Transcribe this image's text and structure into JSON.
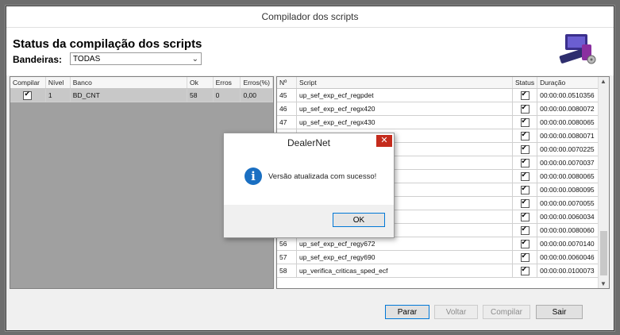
{
  "window": {
    "title": "Compilador dos scripts"
  },
  "header": {
    "title": "Status da compilação dos scripts",
    "flag_label": "Bandeiras:",
    "flag_value": "TODAS"
  },
  "left_grid": {
    "columns": [
      "Compilar",
      "Nível",
      "Banco",
      "Ok",
      "Erros",
      "Erros(%)"
    ],
    "rows": [
      {
        "compilar": true,
        "nivel": "1",
        "banco": "BD_CNT",
        "ok": "58",
        "erros": "0",
        "erros_pct": "0,00"
      }
    ]
  },
  "right_grid": {
    "columns": [
      "Nº",
      "Script",
      "Status",
      "Duração"
    ],
    "rows": [
      {
        "n": "45",
        "script": "up_sef_exp_ecf_regpdet",
        "status": true,
        "duracao": "00:00:00.0510356"
      },
      {
        "n": "46",
        "script": "up_sef_exp_ecf_regx420",
        "status": true,
        "duracao": "00:00:00.0080072"
      },
      {
        "n": "47",
        "script": "up_sef_exp_ecf_regx430",
        "status": true,
        "duracao": "00:00:00.0080065"
      },
      {
        "n": "",
        "script": "",
        "status": true,
        "duracao": "00:00:00.0080071"
      },
      {
        "n": "",
        "script": "",
        "status": true,
        "duracao": "00:00:00.0070225"
      },
      {
        "n": "",
        "script": "",
        "status": true,
        "duracao": "00:00:00.0070037"
      },
      {
        "n": "",
        "script": "",
        "status": true,
        "duracao": "00:00:00.0080065"
      },
      {
        "n": "",
        "script": "",
        "status": true,
        "duracao": "00:00:00.0080095"
      },
      {
        "n": "",
        "script": "",
        "status": true,
        "duracao": "00:00:00.0070055"
      },
      {
        "n": "",
        "script": "",
        "status": true,
        "duracao": "00:00:00.0060034"
      },
      {
        "n": "",
        "script": "",
        "status": true,
        "duracao": "00:00:00.0080060"
      },
      {
        "n": "56",
        "script": "up_sef_exp_ecf_regy672",
        "status": true,
        "duracao": "00:00:00.0070140"
      },
      {
        "n": "57",
        "script": "up_sef_exp_ecf_regy690",
        "status": true,
        "duracao": "00:00:00.0060046"
      },
      {
        "n": "58",
        "script": "up_verifica_criticas_sped_ecf",
        "status": true,
        "duracao": "00:00:00.0100073"
      }
    ]
  },
  "buttons": {
    "parar": "Parar",
    "voltar": "Voltar",
    "compilar": "Compilar",
    "sair": "Sair"
  },
  "dialog": {
    "title": "DealerNet",
    "close": "✕",
    "icon": "i",
    "message": "Versão atualizada com sucesso!",
    "ok": "OK"
  },
  "colors": {
    "accent": "#0078d7",
    "info_icon": "#1a6fc2",
    "close": "#c42b1c"
  }
}
